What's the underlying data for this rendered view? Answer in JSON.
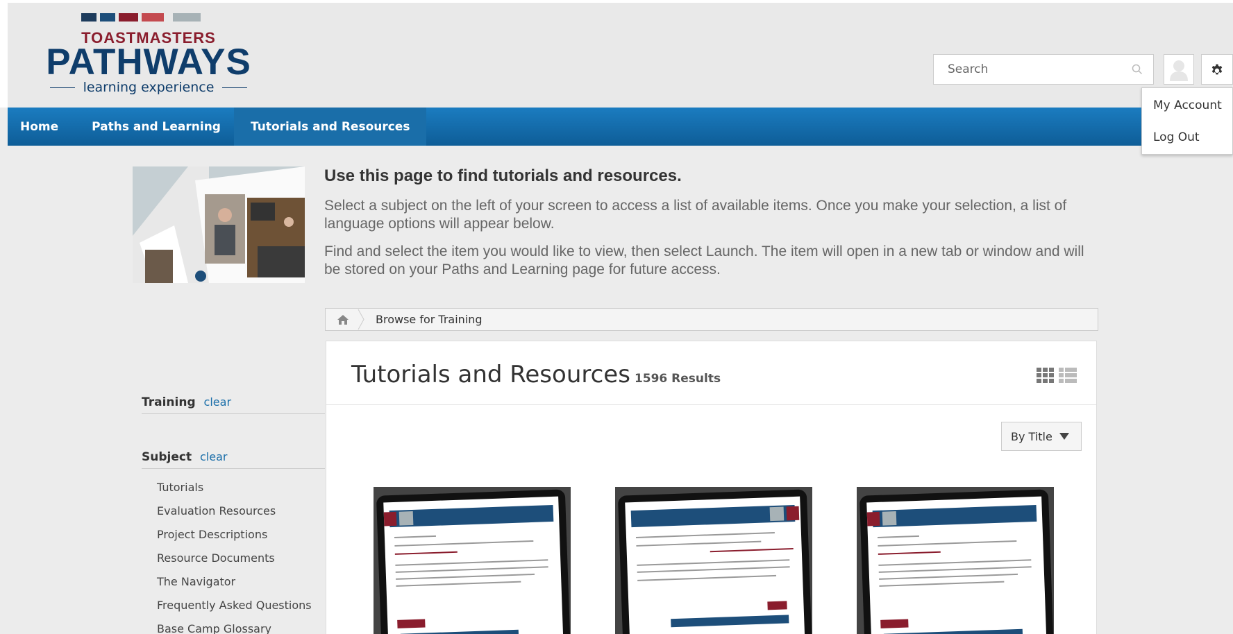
{
  "header": {
    "logo": {
      "top": "TOASTMASTERS",
      "main": "PATHWAYS",
      "sub": "learning experience",
      "bar_colors": [
        "#1d3b5c",
        "#1d4e7a",
        "#8a1d2d",
        "#c44a4f",
        "#a7b2b6"
      ]
    },
    "search": {
      "placeholder": "Search",
      "icon": "search-icon"
    },
    "user_menu": {
      "items": [
        {
          "label": "My Account"
        },
        {
          "label": "Log Out"
        }
      ]
    }
  },
  "nav": {
    "items": [
      {
        "label": "Home"
      },
      {
        "label": "Paths and Learning"
      },
      {
        "label": "Tutorials and Resources",
        "active": true
      }
    ],
    "color": "#1b7cc0"
  },
  "intro": {
    "title": "Use this page to find tutorials and resources.",
    "p1": "Select a subject on the left of your screen to access a list of available items. Once you make your selection, a list of language options will appear below.",
    "p2": "Find and select the item you would like to view, then select Launch. The item will open in a new tab or window and will be stored on your Paths and Learning page for future access."
  },
  "breadcrumb": {
    "label": "Browse for Training"
  },
  "results": {
    "title": "Tutorials and Resources",
    "count": "1596 Results",
    "sort_label": "By Title"
  },
  "sidebar": {
    "training": {
      "heading": "Training",
      "clear": "clear"
    },
    "subject": {
      "heading": "Subject",
      "clear": "clear",
      "items": [
        {
          "label": "Tutorials"
        },
        {
          "label": "Evaluation Resources"
        },
        {
          "label": "Project Descriptions"
        },
        {
          "label": "Resource Documents"
        },
        {
          "label": "The Navigator"
        },
        {
          "label": "Frequently Asked Questions"
        },
        {
          "label": "Base Camp Glossary"
        }
      ]
    }
  }
}
